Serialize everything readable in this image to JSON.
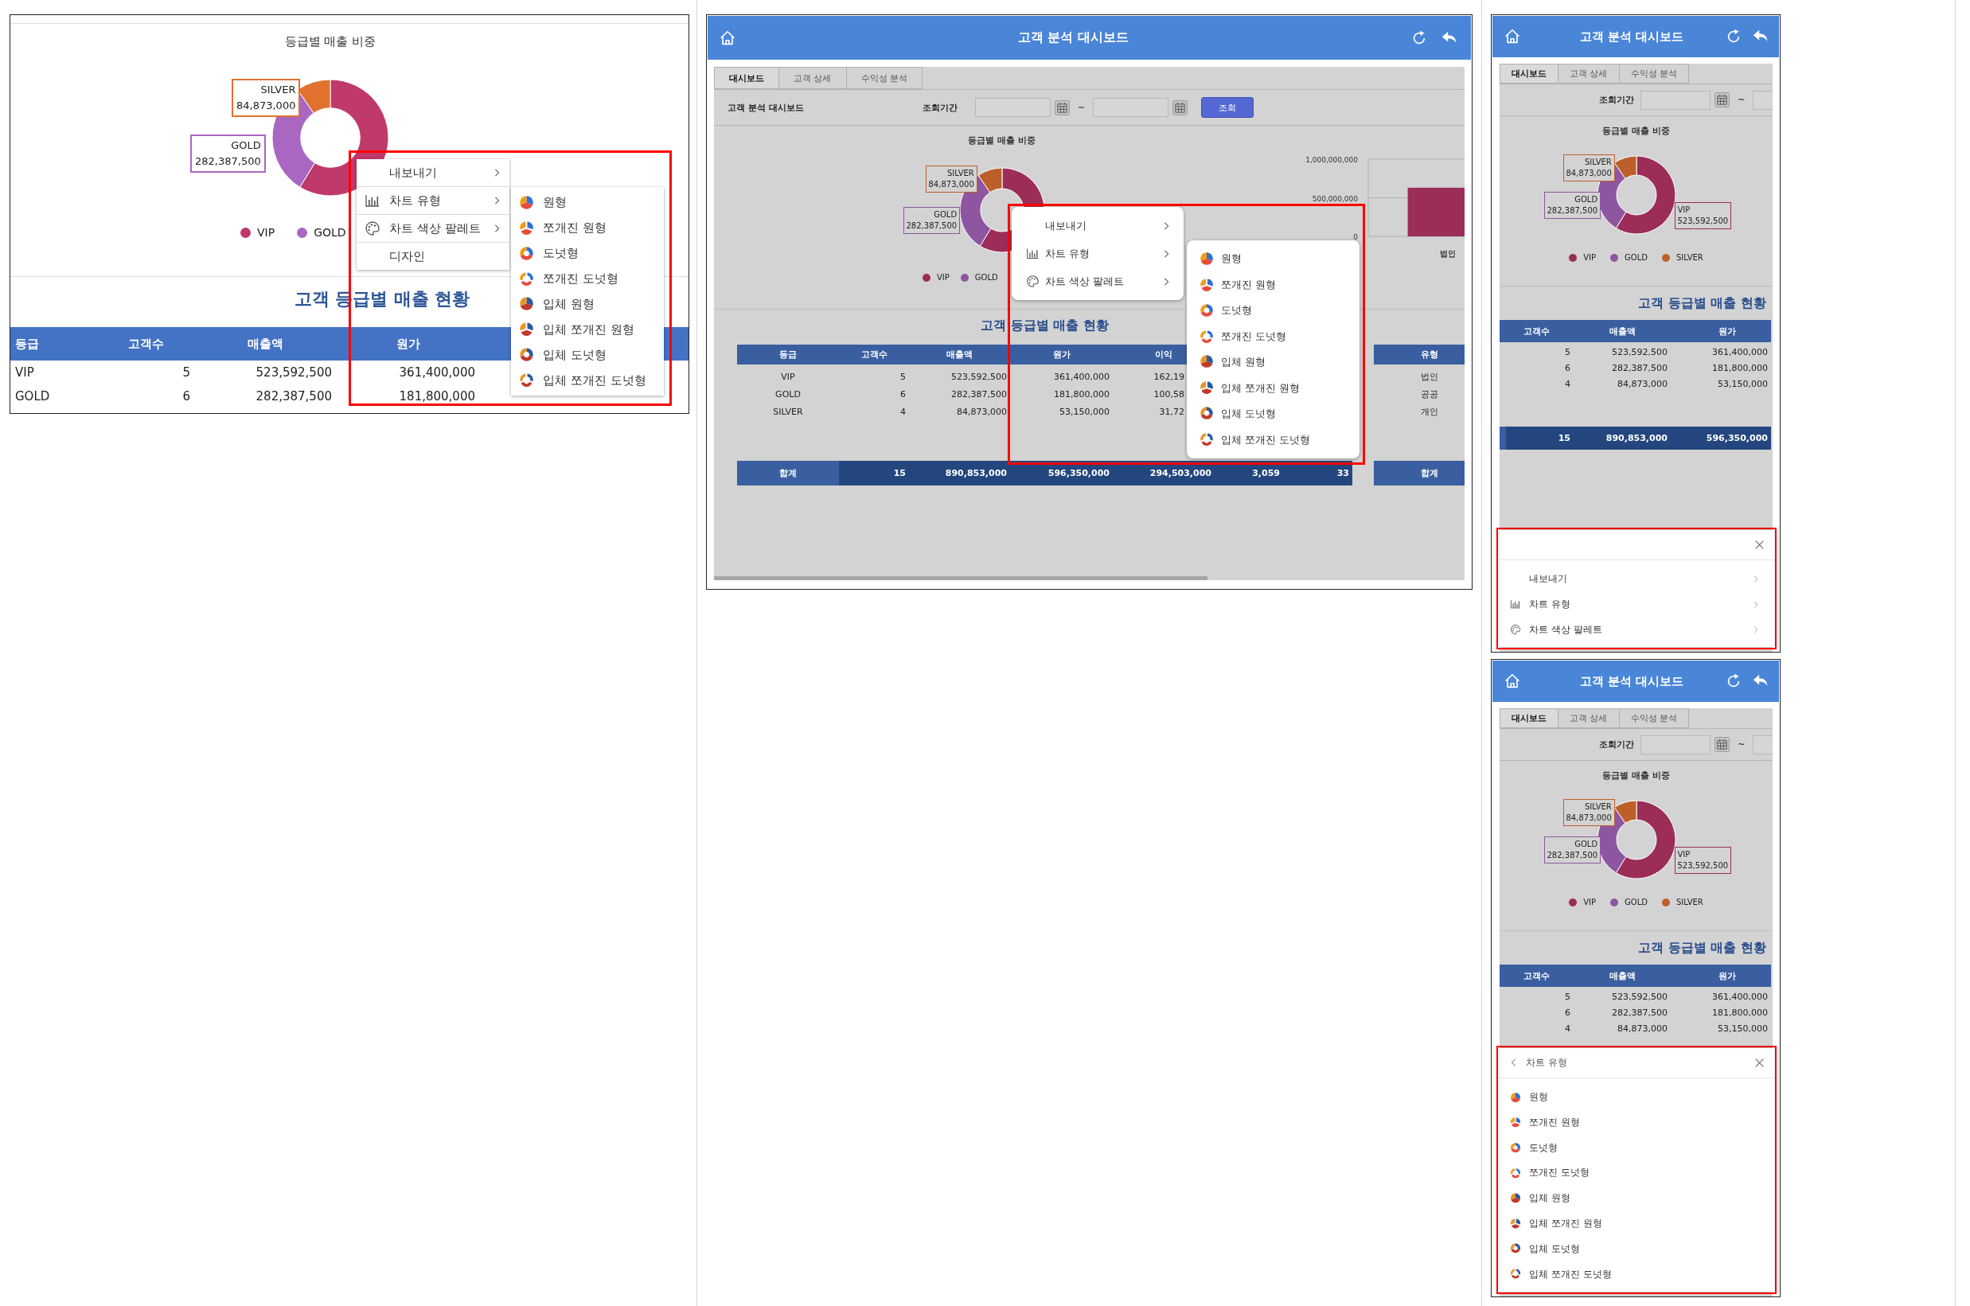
{
  "panels": [
    {
      "kind": "crop",
      "chart": {
        "chart_data": {
          "type": "donut",
          "title": "등급별 매출 비중",
          "categories": [
            "VIP",
            "GOLD",
            "SILVER"
          ],
          "values": [
            523592500,
            282387500,
            84873000
          ],
          "colors": [
            "#c0396b",
            "#a967c2",
            "#e0712f"
          ],
          "value_labels": [
            null,
            "282,387,500",
            "84,873,000"
          ]
        },
        "legend_visible": [
          true,
          true,
          false
        ]
      },
      "table": {
        "title": "고객 등급별 매출 현황",
        "columns": [
          "등급",
          "고객수",
          "매출액",
          "원가"
        ],
        "rows": [
          [
            "VIP",
            "5",
            "523,592,500",
            "361,400,000"
          ],
          [
            "GOLD",
            "6",
            "282,387,500",
            "181,800,000"
          ]
        ]
      },
      "menu": {
        "items": [
          {
            "label": "내보내기",
            "kind": "plain",
            "submenu": true
          },
          {
            "label": "차트 유형",
            "kind": "chart",
            "submenu": true
          },
          {
            "label": "차트 색상 팔레트",
            "kind": "palette",
            "submenu": true
          },
          {
            "label": "디자인",
            "kind": "plain",
            "submenu": false
          }
        ],
        "submenu": [
          {
            "label": "원형",
            "kind": "pie"
          },
          {
            "label": "쪼개진 원형",
            "kind": "exploded-pie"
          },
          {
            "label": "도넛형",
            "kind": "donut"
          },
          {
            "label": "쪼개진 도넛형",
            "kind": "exploded-donut"
          },
          {
            "label": "입체 원형",
            "kind": "pie-3d"
          },
          {
            "label": "입체 쪼개진 원형",
            "kind": "exploded-pie-3d"
          },
          {
            "label": "입체 도넛형",
            "kind": "donut-3d"
          },
          {
            "label": "입체 쪼개진 도넛형",
            "kind": "exploded-donut-3d"
          }
        ]
      }
    },
    {
      "kind": "desktop",
      "header": {
        "title": "고객 분석 대시보드"
      },
      "tabs": [
        {
          "label": "대시보드",
          "selected": true
        },
        {
          "label": "고객 상세",
          "selected": false
        },
        {
          "label": "수익성 분석",
          "selected": false
        }
      ],
      "filter": {
        "title": "고객 분석 대시보드",
        "label": "조회기간",
        "separator": "~",
        "button": "조회"
      },
      "chart": {
        "chart_data": {
          "type": "donut",
          "title": "등급별 매출 비중",
          "categories": [
            "VIP",
            "GOLD",
            "SILVER"
          ],
          "values": [
            523592500,
            282387500,
            84873000
          ],
          "colors": [
            "#9b2d58",
            "#8e56a0",
            "#bd5f2a"
          ],
          "value_labels": [
            null,
            "282,387,500",
            "84,873,000"
          ]
        },
        "legend_visible": [
          true,
          true,
          false
        ]
      },
      "bar_chart": {
        "chart_data": {
          "type": "bar",
          "categories": [
            "법인"
          ],
          "values": [
            630000000
          ],
          "colors": [
            "#9b2d58"
          ],
          "ylim": [
            0,
            1000000000
          ],
          "yticks": [
            {
              "value": 0,
              "label": "0"
            },
            {
              "value": 500000000,
              "label": "500,000,000"
            },
            {
              "value": 1000000000,
              "label": "1,000,000,000"
            }
          ]
        }
      },
      "table": {
        "title": "고객 등급별 매출 현황",
        "columns": [
          "등급",
          "고객수",
          "매출액",
          "원가",
          "이익"
        ],
        "rows": [
          [
            "VIP",
            "5",
            "523,592,500",
            "361,400,000",
            "162,19"
          ],
          [
            "GOLD",
            "6",
            "282,387,500",
            "181,800,000",
            "100,58"
          ],
          [
            "SILVER",
            "4",
            "84,873,000",
            "53,150,000",
            "31,72"
          ]
        ],
        "total": [
          "합계",
          "15",
          "890,853,000",
          "596,350,000",
          "294,503,000",
          "3,059",
          "33"
        ]
      },
      "side_table": {
        "columns": [
          "유형"
        ],
        "rows": [
          [
            "법인"
          ],
          [
            "공공"
          ],
          [
            "개인"
          ]
        ],
        "total": [
          "합계"
        ]
      },
      "menu": {
        "items": [
          {
            "label": "내보내기",
            "kind": "plain",
            "submenu": true
          },
          {
            "label": "차트 유형",
            "kind": "chart",
            "submenu": true
          },
          {
            "label": "차트 색상 팔레트",
            "kind": "palette",
            "submenu": true
          }
        ],
        "submenu": [
          {
            "label": "원형",
            "kind": "pie"
          },
          {
            "label": "쪼개진 원형",
            "kind": "exploded-pie"
          },
          {
            "label": "도넛형",
            "kind": "donut"
          },
          {
            "label": "쪼개진 도넛형",
            "kind": "exploded-donut"
          },
          {
            "label": "입체 원형",
            "kind": "pie-3d"
          },
          {
            "label": "입체 쪼개진 원형",
            "kind": "exploded-pie-3d"
          },
          {
            "label": "입체 도넛형",
            "kind": "donut-3d"
          },
          {
            "label": "입체 쪼개진 도넛형",
            "kind": "exploded-donut-3d"
          }
        ]
      }
    },
    {
      "kind": "mobile",
      "header": {
        "title": "고객 분석 대시보드"
      },
      "tabs": [
        {
          "label": "대시보드",
          "selected": true
        },
        {
          "label": "고객 상세",
          "selected": false
        },
        {
          "label": "수익성 분석",
          "selected": false
        }
      ],
      "filter": {
        "label": "조회기간",
        "separator": "~"
      },
      "chart": {
        "chart_data": {
          "type": "donut",
          "title": "등급별 매출 비중",
          "categories": [
            "VIP",
            "GOLD",
            "SILVER"
          ],
          "values": [
            523592500,
            282387500,
            84873000
          ],
          "colors": [
            "#9b2d58",
            "#8e56a0",
            "#bd5f2a"
          ],
          "value_labels": [
            "523,592,500",
            "282,387,500",
            "84,873,000"
          ]
        },
        "legend_visible": [
          true,
          true,
          true
        ]
      },
      "table": {
        "title": "고객 등급별 매출 현황",
        "columns": [
          "고객수",
          "매출액",
          "원가"
        ],
        "rows": [
          [
            "5",
            "523,592,500",
            "361,400,000"
          ],
          [
            "6",
            "282,387,500",
            "181,800,000"
          ],
          [
            "4",
            "84,873,000",
            "53,150,000"
          ]
        ],
        "total": [
          "15",
          "890,853,000",
          "596,350,000"
        ]
      },
      "sheet": {
        "items": [
          {
            "label": "내보내기",
            "kind": "plain",
            "submenu": true
          },
          {
            "label": "차트 유형",
            "kind": "chart",
            "submenu": true
          },
          {
            "label": "차트 색상 팔레트",
            "kind": "palette",
            "submenu": true
          }
        ]
      }
    },
    {
      "kind": "mobile",
      "header": {
        "title": "고객 분석 대시보드"
      },
      "tabs": [
        {
          "label": "대시보드",
          "selected": true
        },
        {
          "label": "고객 상세",
          "selected": false
        },
        {
          "label": "수익성 분석",
          "selected": false
        }
      ],
      "filter": {
        "label": "조회기간",
        "separator": "~"
      },
      "chart": {
        "chart_data": {
          "type": "donut",
          "title": "등급별 매출 비중",
          "categories": [
            "VIP",
            "GOLD",
            "SILVER"
          ],
          "values": [
            523592500,
            282387500,
            84873000
          ],
          "colors": [
            "#9b2d58",
            "#8e56a0",
            "#bd5f2a"
          ],
          "value_labels": [
            "523,592,500",
            "282,387,500",
            "84,873,000"
          ]
        },
        "legend_visible": [
          true,
          true,
          true
        ]
      },
      "table": {
        "title": "고객 등급별 매출 현황",
        "columns": [
          "고객수",
          "매출액",
          "원가"
        ],
        "rows": [
          [
            "5",
            "523,592,500",
            "361,400,000"
          ],
          [
            "6",
            "282,387,500",
            "181,800,000"
          ],
          [
            "4",
            "84,873,000",
            "53,150,000"
          ]
        ]
      },
      "sheet": {
        "back": true,
        "title": "차트 유형",
        "items": [
          {
            "label": "원형",
            "kind": "pie",
            "submenu": false
          },
          {
            "label": "쪼개진 원형",
            "kind": "exploded-pie",
            "submenu": false
          },
          {
            "label": "도넛형",
            "kind": "donut",
            "submenu": false
          },
          {
            "label": "쪼개진 도넛형",
            "kind": "exploded-donut",
            "submenu": false
          },
          {
            "label": "입체 원형",
            "kind": "pie-3d",
            "submenu": false
          },
          {
            "label": "입체 쪼개진 원형",
            "kind": "exploded-pie-3d",
            "submenu": false
          },
          {
            "label": "입체 도넛형",
            "kind": "donut-3d",
            "submenu": false
          },
          {
            "label": "입체 쪼개진 도넛형",
            "kind": "exploded-donut-3d",
            "submenu": false
          }
        ]
      }
    }
  ]
}
